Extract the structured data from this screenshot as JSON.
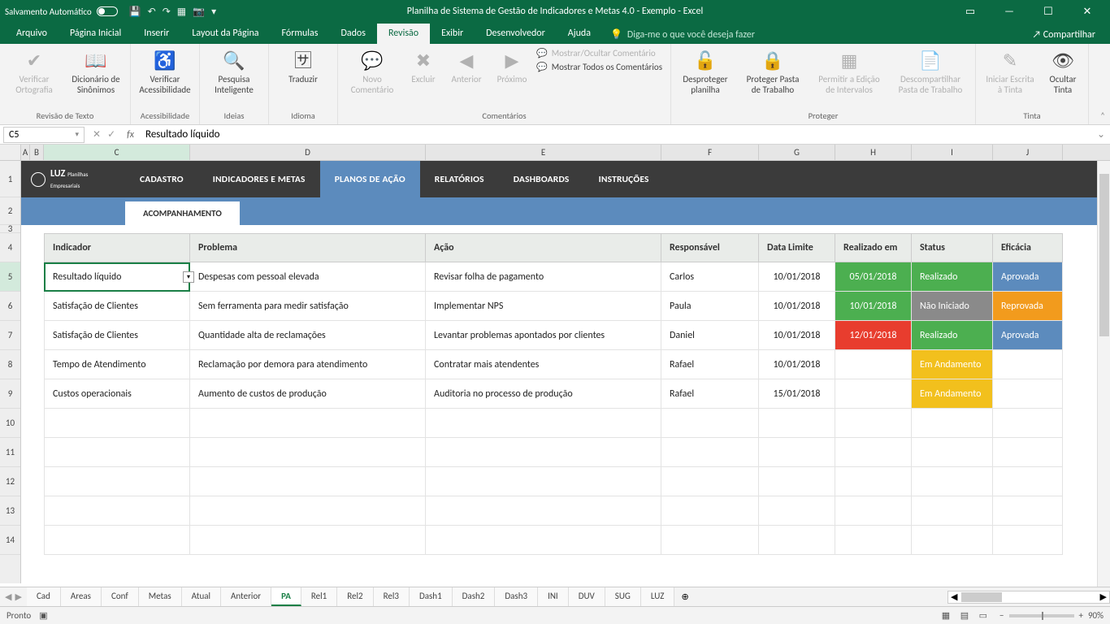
{
  "titlebar": {
    "autosave": "Salvamento Automático",
    "title": "Planilha de Sistema de Gestão de Indicadores e Metas 4.0 - Exemplo  -  Excel"
  },
  "menu": {
    "tabs": [
      "Arquivo",
      "Página Inicial",
      "Inserir",
      "Layout da Página",
      "Fórmulas",
      "Dados",
      "Revisão",
      "Exibir",
      "Desenvolvedor",
      "Ajuda"
    ],
    "tellme": "Diga-me o que você deseja fazer",
    "share": "Compartilhar"
  },
  "ribbon": {
    "g1": {
      "b1": "Verificar\nOrtografia",
      "b2": "Dicionário de\nSinônimos",
      "label": "Revisão de Texto"
    },
    "g2": {
      "b1": "Verificar\nAcessibilidade",
      "label": "Acessibilidade"
    },
    "g3": {
      "b1": "Pesquisa\nInteligente",
      "label": "Ideias"
    },
    "g4": {
      "b1": "Traduzir",
      "label": "Idioma"
    },
    "g5": {
      "b1": "Novo\nComentário",
      "b2": "Excluir",
      "b3": "Anterior",
      "b4": "Próximo",
      "s1": "Mostrar/Ocultar Comentário",
      "s2": "Mostrar Todos os Comentários",
      "label": "Comentários"
    },
    "g6": {
      "b1": "Desproteger\nplanilha",
      "b2": "Proteger Pasta\nde Trabalho",
      "b3": "Permitir a Edição\nde Intervalos",
      "b4": "Descompartilhar\nPasta de Trabalho",
      "label": "Proteger"
    },
    "g7": {
      "b1": "Iniciar Escrita\nà Tinta",
      "b2": "Ocultar\nTinta",
      "label": "Tinta"
    }
  },
  "fbar": {
    "name": "C5",
    "formula": "Resultado líquido"
  },
  "cols": [
    "A",
    "B",
    "C",
    "D",
    "E",
    "F",
    "G",
    "H",
    "I",
    "J"
  ],
  "app": {
    "logo": "LUZ",
    "logosub": "Planilhas\nEmpresariais",
    "nav": [
      "CADASTRO",
      "INDICADORES E METAS",
      "PLANOS DE AÇÃO",
      "RELATÓRIOS",
      "DASHBOARDS",
      "INSTRUÇÕES"
    ],
    "subtab": "ACOMPANHAMENTO"
  },
  "table": {
    "headers": [
      "Indicador",
      "Problema",
      "Ação",
      "Responsável",
      "Data Limite",
      "Realizado em",
      "Status",
      "Eficácia"
    ],
    "rows": [
      {
        "ind": "Resultado líquido",
        "prob": "Despesas com pessoal elevada",
        "acao": "Revisar folha de pagamento",
        "resp": "Carlos",
        "limite": "10/01/2018",
        "real": "05/01/2018",
        "realC": "#4caf50",
        "status": "Realizado",
        "statusC": "#4caf50",
        "efic": "Aprovada",
        "eficC": "#5c8bbd"
      },
      {
        "ind": "Satisfação de Clientes",
        "prob": "Sem ferramenta para medir satisfação",
        "acao": "Implementar NPS",
        "resp": "Paula",
        "limite": "10/01/2018",
        "real": "10/01/2018",
        "realC": "#4caf50",
        "status": "Não Iniciado",
        "statusC": "#8a8a8a",
        "efic": "Reprovada",
        "eficC": "#f29b1d"
      },
      {
        "ind": "Satisfação de Clientes",
        "prob": "Quantidade alta de reclamações",
        "acao": "Levantar problemas apontados por clientes",
        "resp": "Daniel",
        "limite": "10/01/2018",
        "real": "12/01/2018",
        "realC": "#e83d2e",
        "status": "Realizado",
        "statusC": "#4caf50",
        "efic": "Aprovada",
        "eficC": "#5c8bbd"
      },
      {
        "ind": "Tempo de Atendimento",
        "prob": "Reclamação por demora para atendimento",
        "acao": "Contratar mais atendentes",
        "resp": "Rafael",
        "limite": "10/01/2018",
        "real": "",
        "realC": "",
        "status": "Em Andamento",
        "statusC": "#f2c01d",
        "efic": "",
        "eficC": ""
      },
      {
        "ind": "Custos operacionais",
        "prob": "Aumento de custos de produção",
        "acao": "Auditoria no processo de produção",
        "resp": "Rafael",
        "limite": "15/01/2018",
        "real": "",
        "realC": "",
        "status": "Em Andamento",
        "statusC": "#f2c01d",
        "efic": "",
        "eficC": ""
      }
    ]
  },
  "sheets": [
    "Cad",
    "Areas",
    "Conf",
    "Metas",
    "Atual",
    "Anterior",
    "PA",
    "Rel1",
    "Rel2",
    "Rel3",
    "Dash1",
    "Dash2",
    "Dash3",
    "INI",
    "DUV",
    "SUG",
    "LUZ"
  ],
  "status": {
    "ready": "Pronto",
    "zoom": "90%"
  }
}
